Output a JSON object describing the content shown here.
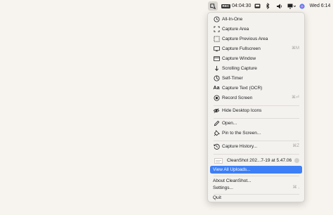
{
  "menubar": {
    "timer": "04:04:30",
    "rec_badge": "REC",
    "clock": "Wed 6:14"
  },
  "menu": {
    "all_in_one": "All-In-One",
    "capture_area": "Capture Area",
    "capture_previous_area": "Capture Previous Area",
    "capture_fullscreen": "Capture Fullscreen",
    "capture_fullscreen_shortcut": "⌘M",
    "capture_window": "Capture Window",
    "scrolling_capture": "Scrolling Capture",
    "self_timer": "Self-Timer",
    "capture_text": "Capture Text (OCR)",
    "record_screen": "Record Screen",
    "record_screen_shortcut": "⌘⏎",
    "hide_desktop_icons": "Hide Desktop Icons",
    "open": "Open...",
    "pin_to_screen": "Pin to the Screen...",
    "capture_history": "Capture History...",
    "capture_history_shortcut": "⌘Z",
    "recent_file": "CleanShot 202...7-19 at 5.47.06",
    "view_all_uploads": "View All Uploads...",
    "about": "About CleanShot...",
    "settings": "Settings...",
    "settings_shortcut": "⌘ ,",
    "quit": "Quit"
  },
  "colors": {
    "selection": "#3d7ff6",
    "background": "#f7f3ee"
  }
}
